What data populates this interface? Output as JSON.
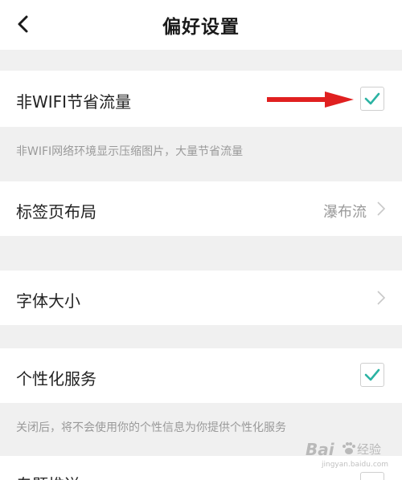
{
  "header": {
    "title": "偏好设置",
    "back_icon": "chevron-left-icon"
  },
  "settings": {
    "wifi_saving": {
      "label": "非WIFI节省流量",
      "checked": true,
      "note": "非WIFI网络环境显示压缩图片，大量节省流量"
    },
    "tab_layout": {
      "label": "标签页布局",
      "value": "瀑布流"
    },
    "font_size": {
      "label": "字体大小"
    },
    "personalization": {
      "label": "个性化服务",
      "checked": true,
      "note": "关闭后，将不会使用你的个性信息为你提供个性化服务"
    },
    "partial_row": {
      "label": "专题推送"
    }
  },
  "annotation": {
    "arrow_color": "#e02020"
  },
  "watermark": {
    "logo": "Bai",
    "logo_suffix": "经验",
    "url": "jingyan.baidu.com"
  },
  "colors": {
    "check_accent": "#2bb3a3",
    "background": "#f0f0f0",
    "card": "#ffffff"
  }
}
